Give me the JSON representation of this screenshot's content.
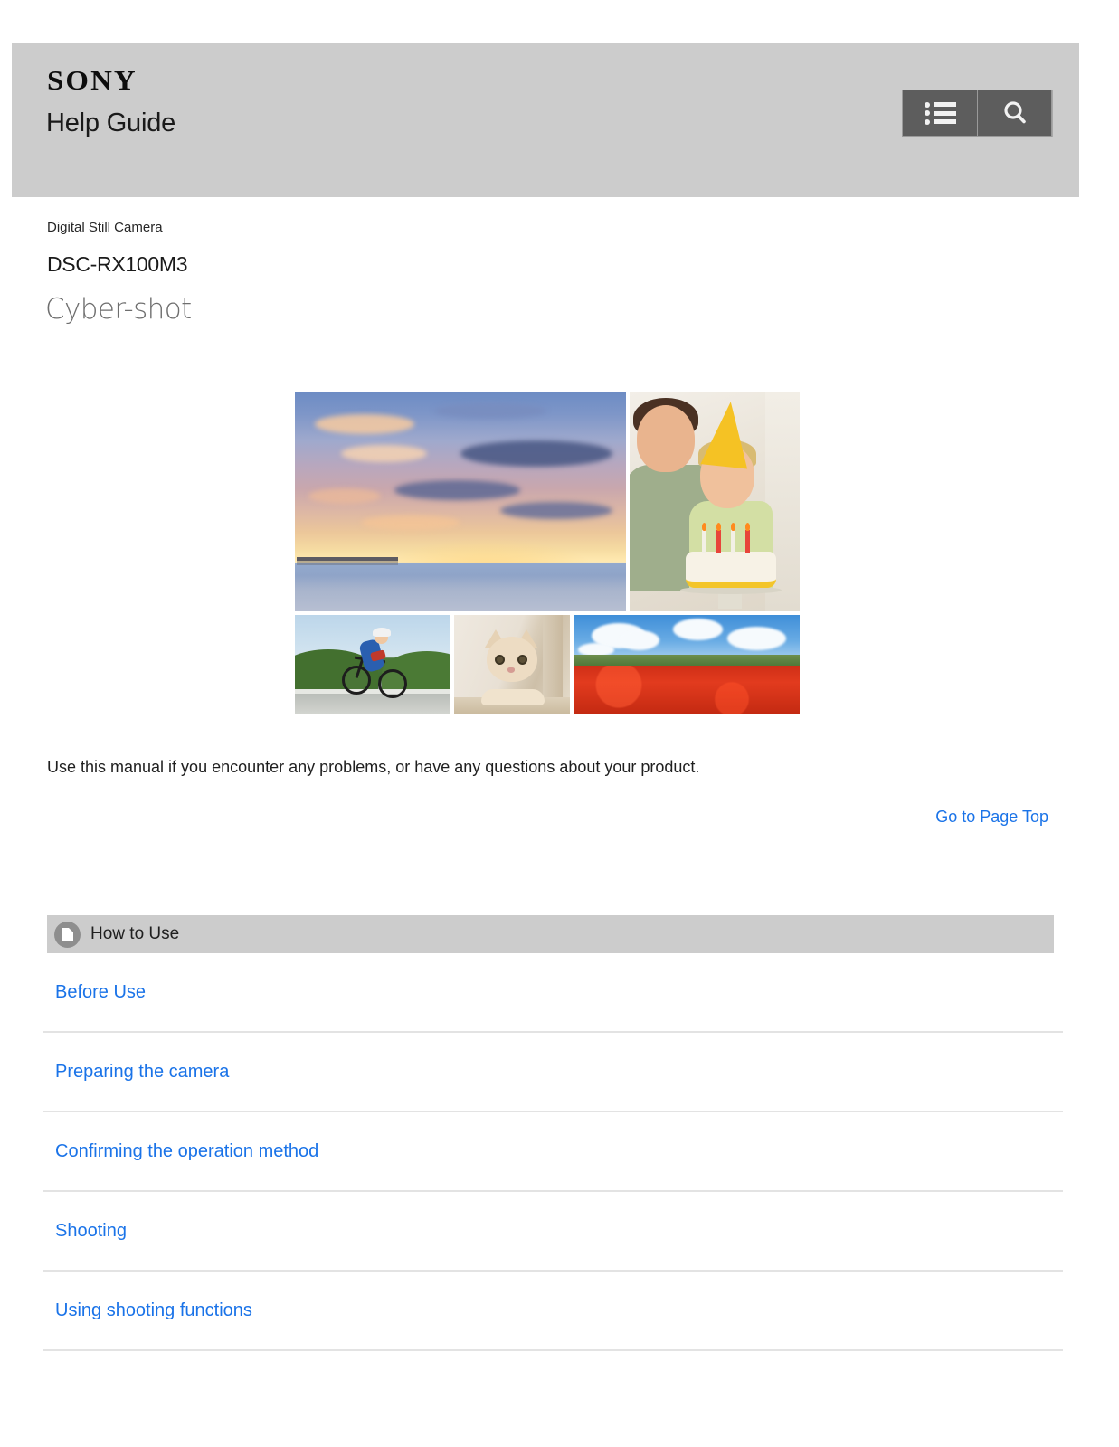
{
  "header": {
    "brand": "SONY",
    "title": "Help Guide",
    "menu_button_label": "menu",
    "search_button_label": "search"
  },
  "product": {
    "category": "Digital Still Camera",
    "model": "DSC-RX100M3",
    "series_logo": "Cyber-shot"
  },
  "gallery": {
    "photos": [
      {
        "name": "sunset-beach-pier"
      },
      {
        "name": "father-and-son-birthday-cake"
      },
      {
        "name": "cyclist-on-coastal-road"
      },
      {
        "name": "cat-peeking"
      },
      {
        "name": "red-poppy-field"
      }
    ]
  },
  "content": {
    "lead": "Use this manual if you encounter any problems, or have any questions about your product.",
    "page_top_link": "Go to Page Top"
  },
  "how_to_use": {
    "section_title": "How to Use",
    "icon": "document-page-icon",
    "links": [
      {
        "label": "Before Use"
      },
      {
        "label": "Preparing the camera"
      },
      {
        "label": "Confirming the operation method"
      },
      {
        "label": "Shooting"
      },
      {
        "label": "Using shooting functions"
      }
    ]
  },
  "colors": {
    "header_background": "#cccccc",
    "button_background": "#5d5d5d",
    "link_blue": "#1a73e8",
    "separator": "#e3e3e3"
  }
}
